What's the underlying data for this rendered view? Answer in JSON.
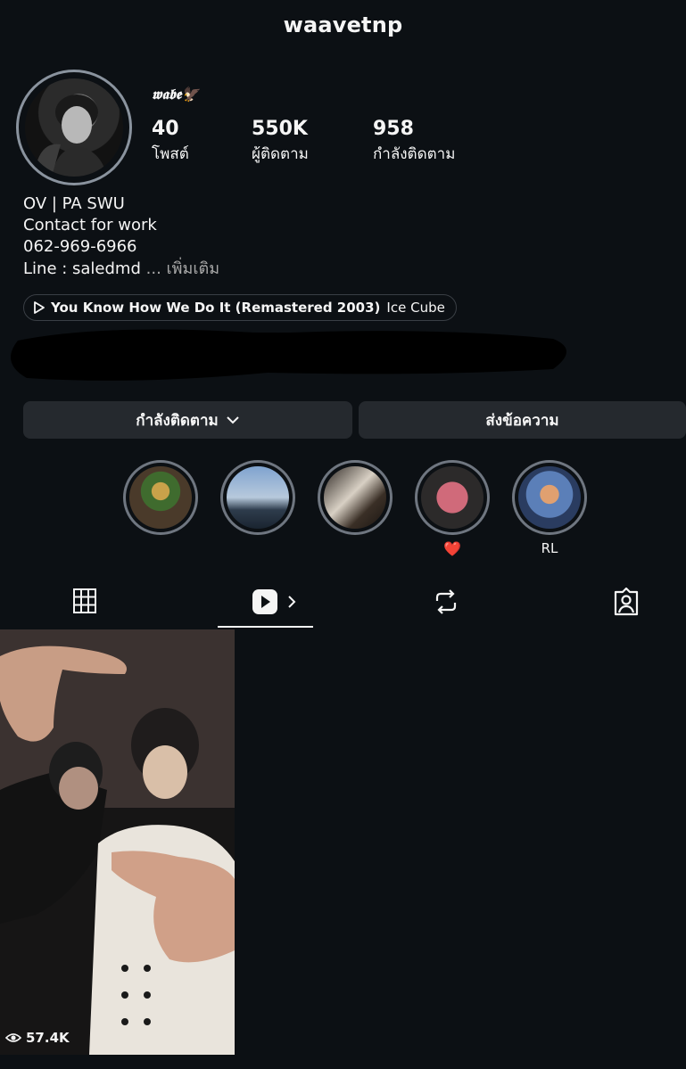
{
  "header": {
    "username": "waavetnp"
  },
  "profile": {
    "display_name": "𝖜𝖆𝖇𝖊🦅",
    "stats": [
      {
        "value": "40",
        "label": "โพสต์"
      },
      {
        "value": "550K",
        "label": "ผู้ติดตาม"
      },
      {
        "value": "958",
        "label": "กำลังติดตาม"
      }
    ],
    "bio": [
      "OV | PA SWU",
      "Contact for work",
      "062-969-6966",
      "Line : saledmd"
    ],
    "bio_more": "... เพิ่มเติม",
    "music": {
      "title": "You Know How We Do It (Remastered 2003)",
      "artist": "Ice Cube"
    }
  },
  "actions": {
    "following": "กำลังติดตาม",
    "message": "ส่งข้อความ"
  },
  "highlights": [
    {
      "label": ""
    },
    {
      "label": ""
    },
    {
      "label": ""
    },
    {
      "label": "❤️"
    },
    {
      "label": "RL"
    }
  ],
  "tabs": [
    "grid-icon",
    "reels-icon",
    "reposts-icon",
    "tagged-icon"
  ],
  "reels": [
    {
      "views": "57.4K"
    }
  ]
}
